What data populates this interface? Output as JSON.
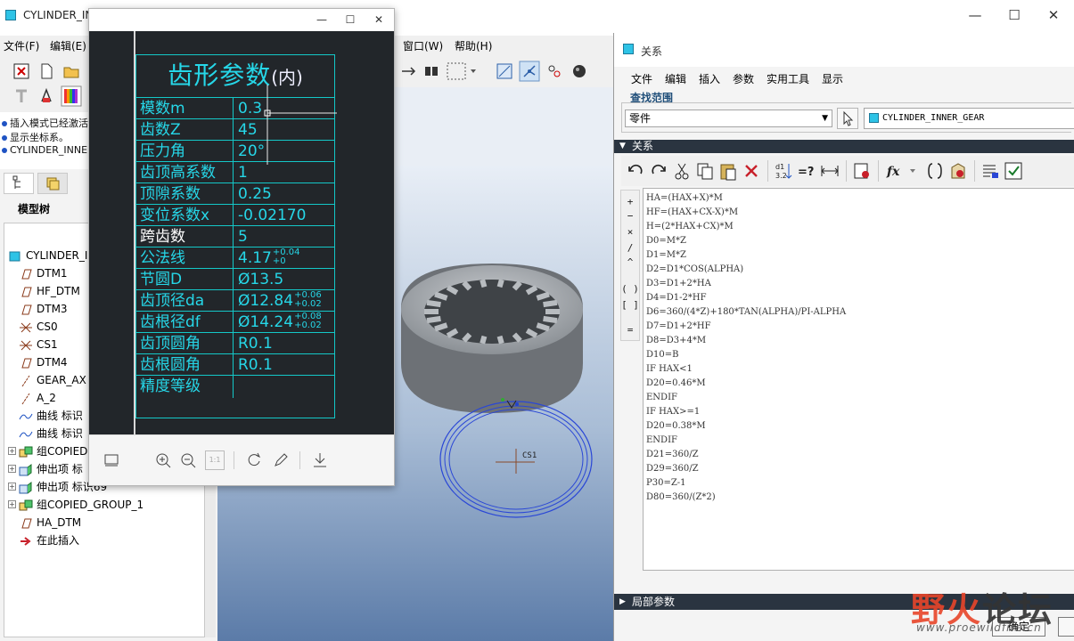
{
  "app": {
    "title": "CYLINDER_IN",
    "menus": {
      "file": "文件(F)",
      "edit": "编辑(E)",
      "window": "窗口(W)",
      "help": "帮助(H)"
    }
  },
  "messages": [
    "插入模式已经激活",
    "显示坐标系。",
    "CYLINDER_INNE"
  ],
  "model_tree": {
    "label": "模型树",
    "items": [
      {
        "label": "CYLINDER_IN",
        "icon": "part-icon"
      },
      {
        "label": "DTM1",
        "icon": "datum-plane-icon"
      },
      {
        "label": "HF_DTM",
        "icon": "datum-plane-icon"
      },
      {
        "label": "DTM3",
        "icon": "datum-plane-icon"
      },
      {
        "label": "CS0",
        "icon": "coordinate-system-icon"
      },
      {
        "label": "CS1",
        "icon": "coordinate-system-icon"
      },
      {
        "label": "DTM4",
        "icon": "datum-plane-icon"
      },
      {
        "label": "GEAR_AX",
        "icon": "datum-axis-icon"
      },
      {
        "label": "A_2",
        "icon": "datum-axis-icon"
      },
      {
        "label": "曲线 标识",
        "icon": "curve-icon"
      },
      {
        "label": "曲线 标识",
        "icon": "curve-icon"
      },
      {
        "label": "组COPIED",
        "icon": "group-icon"
      },
      {
        "label": "伸出项 标",
        "icon": "extrude-icon"
      },
      {
        "label": "伸出项 标识69",
        "icon": "extrude-icon"
      },
      {
        "label": "组COPIED_GROUP_1",
        "icon": "group-icon"
      },
      {
        "label": "HA_DTM",
        "icon": "datum-plane-icon"
      },
      {
        "label": "在此插入",
        "icon": "insert-here-icon"
      }
    ]
  },
  "viewer": {
    "table_title": "齿形参数",
    "table_title_suffix": "(内)",
    "rows": [
      {
        "name": "模数m",
        "value": "0.3",
        "tol_up": "",
        "tol_dn": ""
      },
      {
        "name": "齿数Z",
        "value": "45",
        "tol_up": "",
        "tol_dn": ""
      },
      {
        "name": "压力角",
        "value": "20°",
        "tol_up": "",
        "tol_dn": ""
      },
      {
        "name": "齿顶高系数",
        "value": "1",
        "tol_up": "",
        "tol_dn": ""
      },
      {
        "name": "顶隙系数",
        "value": "0.25",
        "tol_up": "",
        "tol_dn": ""
      },
      {
        "name": "变位系数x",
        "value": "-0.02170",
        "tol_up": "",
        "tol_dn": ""
      },
      {
        "name": "跨齿数",
        "value": "5",
        "tol_up": "",
        "tol_dn": ""
      },
      {
        "name": "公法线",
        "value": "4.17",
        "tol_up": "+0.04",
        "tol_dn": "+0"
      },
      {
        "name": "节圆D",
        "value": "Ø13.5",
        "tol_up": "",
        "tol_dn": ""
      },
      {
        "name": "齿顶径da",
        "value": "Ø12.84",
        "tol_up": "+0.06",
        "tol_dn": "+0.02"
      },
      {
        "name": "齿根径df",
        "value": "Ø14.24",
        "tol_up": "+0.08",
        "tol_dn": "+0.02"
      },
      {
        "name": "齿顶圆角",
        "value": "R0.1",
        "tol_up": "",
        "tol_dn": ""
      },
      {
        "name": "齿根圆角",
        "value": "R0.1",
        "tol_up": "",
        "tol_dn": ""
      },
      {
        "name": "精度等级",
        "value": "",
        "tol_up": "",
        "tol_dn": ""
      }
    ],
    "zoom_box": "1:1"
  },
  "graphics": {
    "cs_label": "CS1"
  },
  "relations": {
    "title": "关系",
    "menus": [
      "文件",
      "编辑",
      "插入",
      "参数",
      "实用工具",
      "显示"
    ],
    "find_scope_label": "查找范围",
    "scope_value": "零件",
    "model_name": "CYLINDER_INNER_GEAR",
    "section_label": "关系",
    "operators": [
      "+",
      "−",
      "×",
      "/",
      "^",
      "( )",
      "[ ]",
      "="
    ],
    "lines": [
      "HA=(HAX+X)*M",
      "HF=(HAX+CX-X)*M",
      "H=(2*HAX+CX)*M",
      "D0=M*Z",
      "D1=M*Z",
      "D2=D1*COS(ALPHA)",
      "D3=D1+2*HA",
      "D4=D1-2*HF",
      "D6=360/(4*Z)+180*TAN(ALPHA)/PI-ALPHA",
      "D7=D1+2*HF",
      "D8=D3+4*M",
      "D10=B",
      "IF HAX<1",
      "D20=0.46*M",
      "ENDIF",
      "IF HAX>=1",
      "D20=0.38*M",
      "ENDIF",
      "D21=360/Z",
      "D29=360/Z",
      "P30=Z-1",
      "D80=360/(Z*2)"
    ],
    "local_params_label": "局部参数",
    "ok_label": "确定"
  },
  "watermark": {
    "text_red": "野火",
    "text_dark": "论坛",
    "url": "www.proewildfire.cn"
  },
  "colors": {
    "cad_cyan": "#26d7e8",
    "section_bar": "#2a3440",
    "accent_blue": "#1f53c3"
  }
}
